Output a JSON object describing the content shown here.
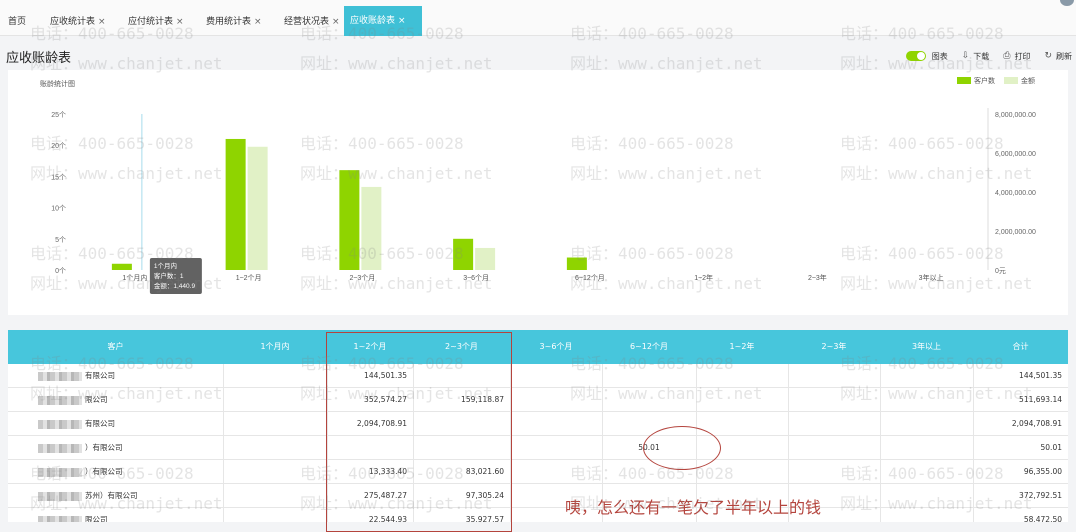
{
  "tabs": [
    {
      "label": "首页",
      "close": ""
    },
    {
      "label": "应收统计表",
      "close": "×"
    },
    {
      "label": "应付统计表",
      "close": "×"
    },
    {
      "label": "费用统计表",
      "close": "×"
    },
    {
      "label": "经营状况表",
      "close": "×"
    },
    {
      "label": "应收账龄表",
      "close": "×"
    }
  ],
  "page": {
    "title": "应收账龄表"
  },
  "toolbar": {
    "chart": "图表",
    "download": "下载",
    "print": "打印",
    "refresh": "刷新"
  },
  "chart_data": {
    "type": "bar",
    "title": "账龄统计图",
    "categories": [
      "1个月内",
      "1~2个月",
      "2~3个月",
      "3~6个月",
      "6~12个月",
      "1~2年",
      "2~3年",
      "3年以上"
    ],
    "series": [
      {
        "name": "客户数",
        "axis": "left",
        "color": "#8fd400",
        "values": [
          1,
          21,
          16,
          5,
          2,
          0,
          0,
          0
        ]
      },
      {
        "name": "金额",
        "axis": "right",
        "color": "#e1f1c6",
        "values": [
          1440.9,
          6320000,
          4260000,
          1130000,
          0,
          0,
          0,
          0
        ]
      }
    ],
    "left_ticks": [
      "0个",
      "5个",
      "10个",
      "15个",
      "20个",
      "25个"
    ],
    "left_max": 25,
    "right_ticks": [
      "0元",
      "2,000,000.00",
      "4,000,000.00",
      "6,000,000.00",
      "8,000,000.00"
    ],
    "right_max": 8000000,
    "tooltip": {
      "title": "1个月内",
      "line1": "客户数：1",
      "line2": "金额：1,440.9"
    }
  },
  "table": {
    "headers": [
      "客户",
      "1个月内",
      "1~2个月",
      "2~3个月",
      "3~6个月",
      "6~12个月",
      "1~2年",
      "2~3年",
      "3年以上",
      "合计"
    ],
    "rows": [
      {
        "name": "有限公司",
        "cells": [
          "",
          "144,501.35",
          "",
          "",
          "",
          "",
          "",
          "",
          "144,501.35"
        ]
      },
      {
        "name": "限公司",
        "cells": [
          "",
          "352,574.27",
          "159,118.87",
          "",
          "",
          "",
          "",
          "",
          "511,693.14"
        ]
      },
      {
        "name": "有限公司",
        "cells": [
          "",
          "2,094,708.91",
          "",
          "",
          "",
          "",
          "",
          "",
          "2,094,708.91"
        ]
      },
      {
        "name": "）有限公司",
        "cells": [
          "",
          "",
          "",
          "",
          "50.01",
          "",
          "",
          "",
          "50.01"
        ]
      },
      {
        "name": "）有限公司",
        "cells": [
          "",
          "13,333.40",
          "83,021.60",
          "",
          "",
          "",
          "",
          "",
          "96,355.00"
        ]
      },
      {
        "name": "苏州）有限公司",
        "cells": [
          "",
          "275,487.27",
          "97,305.24",
          "",
          "",
          "",
          "",
          "",
          "372,792.51"
        ]
      },
      {
        "name": "限公司",
        "cells": [
          "",
          "22,544.93",
          "35,927.57",
          "",
          "",
          "",
          "",
          "",
          "58,472.50"
        ]
      }
    ]
  },
  "annotation": "咦，怎么还有一笔欠了半年以上的钱",
  "watermark": {
    "phone": "电话：400-665-0028",
    "web": "网址：www.chanjet.net"
  }
}
